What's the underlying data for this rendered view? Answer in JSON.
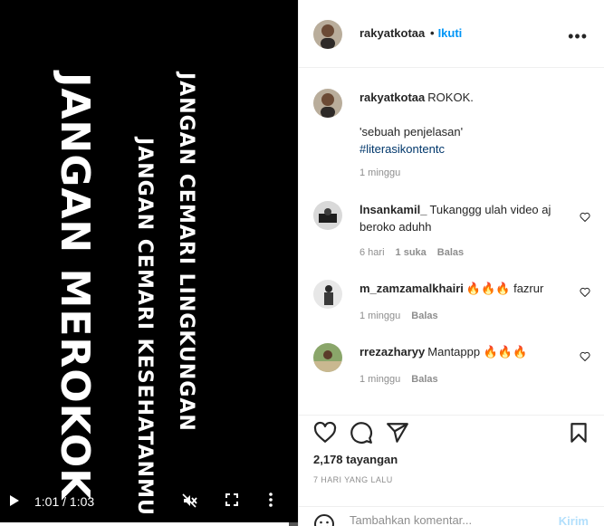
{
  "video": {
    "lines": [
      "JANGAN MEROKOK",
      "JANGAN CEMARI KESEHATANMU",
      "JANGAN CEMARI LINGKUNGAN"
    ],
    "time": "1:01 / 1:03",
    "progress": 0.97,
    "icons": {
      "play": "play-icon",
      "mute": "muted-speaker-icon",
      "fullscreen": "fullscreen-icon",
      "more": "vertical-dots-icon"
    }
  },
  "header": {
    "username": "rakyatkotaa",
    "dot": "•",
    "follow": "Ikuti",
    "more": "•••"
  },
  "caption": {
    "username": "rakyatkotaa",
    "text": "ROKOK.",
    "quote": "'sebuah penjelasan'",
    "hashtag": "#literasikontentc",
    "time": "1 minggu"
  },
  "comments": [
    {
      "username": "lnsankamil_",
      "text": "Tukanggg ulah video aj beroko aduhh",
      "time": "6 hari",
      "likes": "1 suka",
      "reply": "Balas"
    },
    {
      "username": "m_zamzamalkhairi",
      "text": "🔥🔥🔥 fazrur",
      "time": "1 minggu",
      "reply": "Balas"
    },
    {
      "username": "rrezazharyy",
      "text": "Mantappp 🔥🔥🔥",
      "time": "1 minggu",
      "reply": "Balas"
    }
  ],
  "actions": {
    "views": "2,178 tayangan",
    "ago": "7 HARI YANG LALU",
    "icons": {
      "like": "heart-icon",
      "comment": "comment-icon",
      "share": "share-icon",
      "save": "bookmark-icon"
    }
  },
  "add_comment": {
    "placeholder": "Tambahkan komentar...",
    "post": "Kirim",
    "icon": "emoji-icon"
  },
  "colors": {
    "link": "#0095f6",
    "hashtag": "#00376b",
    "muted": "#8e8e8e",
    "post_disabled": "#b2dffc",
    "video_bg": "#000000"
  }
}
